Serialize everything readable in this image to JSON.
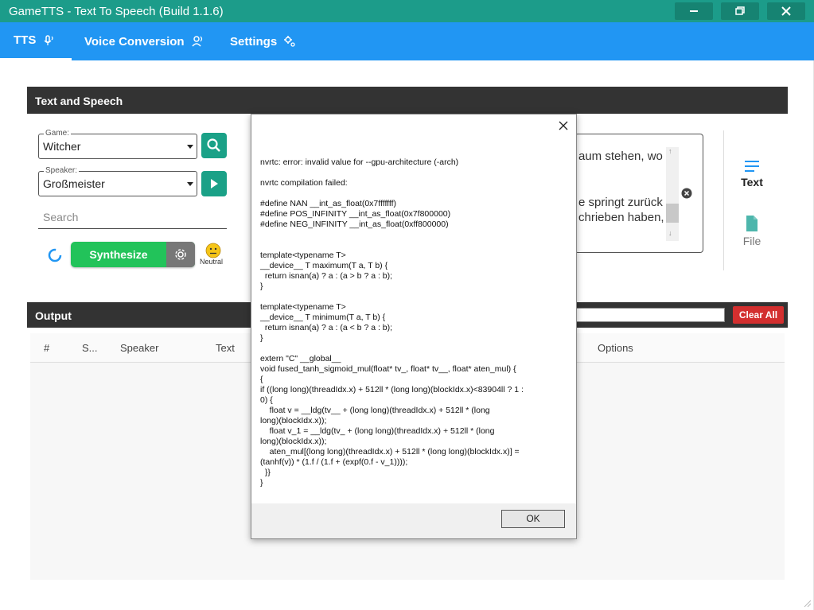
{
  "window": {
    "title": "GameTTS - Text To Speech (Build 1.1.6)",
    "controls": [
      "minimize",
      "restore",
      "close"
    ]
  },
  "tabs": [
    {
      "label": "TTS",
      "active": true
    },
    {
      "label": "Voice Conversion",
      "active": false
    },
    {
      "label": "Settings",
      "active": false
    }
  ],
  "text_speech": {
    "header": "Text and Speech",
    "game_label": "Game:",
    "game_value": "Witcher",
    "speaker_label": "Speaker:",
    "speaker_value": "Großmeister",
    "search_placeholder": "Search",
    "synthesize_label": "Synthesize",
    "emotion_label": "Neutral",
    "text_fragment_1": "aum stehen, wo",
    "text_fragment_2": "e springt zurück",
    "text_fragment_3": "chrieben haben,",
    "side_text_label": "Text",
    "side_file_label": "File"
  },
  "output": {
    "header": "Output",
    "clear_label": "Clear All",
    "columns": [
      "#",
      "S...",
      "Speaker",
      "Text",
      "Options"
    ]
  },
  "dialog": {
    "message_lines": [
      "nvrtc: error: invalid value for --gpu-architecture (-arch)",
      "",
      "nvrtc compilation failed:",
      "",
      "#define NAN __int_as_float(0x7fffffff)",
      "#define POS_INFINITY __int_as_float(0x7f800000)",
      "#define NEG_INFINITY __int_as_float(0xff800000)",
      "",
      "",
      "template<typename T>",
      "__device__ T maximum(T a, T b) {",
      "  return isnan(a) ? a : (a > b ? a : b);",
      "}",
      "",
      "template<typename T>",
      "__device__ T minimum(T a, T b) {",
      "  return isnan(a) ? a : (a < b ? a : b);",
      "}",
      "",
      "extern \"C\" __global__",
      "void fused_tanh_sigmoid_mul(float* tv_, float* tv__, float* aten_mul) {",
      "{",
      "if ((long long)(threadIdx.x) + 512ll * (long long)(blockIdx.x)<83904ll ? 1 :",
      "0) {",
      "    float v = __ldg(tv__ + (long long)(threadIdx.x) + 512ll * (long",
      "long)(blockIdx.x));",
      "    float v_1 = __ldg(tv_ + (long long)(threadIdx.x) + 512ll * (long",
      "long)(blockIdx.x));",
      "    aten_mul[(long long)(threadIdx.x) + 512ll * (long long)(blockIdx.x)] =",
      "(tanhf(v)) * (1.f / (1.f + (expf(0.f - v_1))));",
      "  }}",
      "}"
    ],
    "ok_label": "OK"
  },
  "colors": {
    "titlebar": "#1c9c8a",
    "tabbar": "#2196f3",
    "teal_button": "#1aa187",
    "synthesize": "#22c35a",
    "clear_all": "#d32f2f",
    "panel_header": "#333333"
  }
}
